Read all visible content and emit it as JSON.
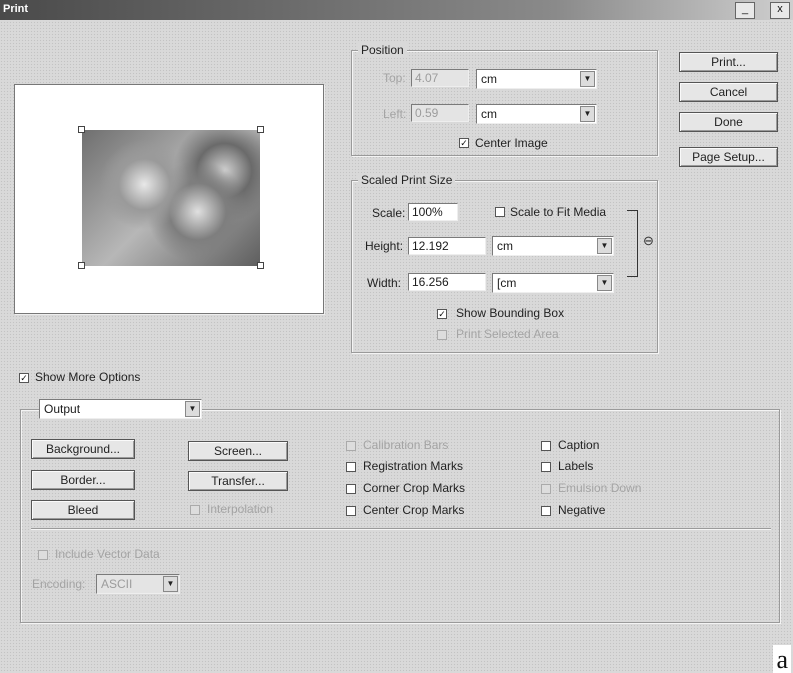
{
  "window": {
    "title": "Print",
    "minimize": "_",
    "close": "x"
  },
  "position": {
    "legend": "Position",
    "top_label": "Top:",
    "top_value": "4.07",
    "top_unit": "cm",
    "left_label": "Left:",
    "left_value": "0.59",
    "left_unit": "cm",
    "center_image_label": "Center Image",
    "center_image_checked": true
  },
  "scaled": {
    "legend": "Scaled Print Size",
    "scale_label": "Scale:",
    "scale_value": "100%",
    "scale_to_fit_label": "Scale to Fit Media",
    "height_label": "Height:",
    "height_value": "12.192",
    "height_unit": "cm",
    "width_label": "Width:",
    "width_value": "16.256",
    "width_unit": "[cm",
    "show_bbox_label": "Show Bounding Box",
    "print_selected_label": "Print Selected Area"
  },
  "buttons": {
    "print": "Print...",
    "cancel": "Cancel",
    "done": "Done",
    "page_setup": "Page Setup..."
  },
  "more_options": {
    "label": "Show More Options",
    "dropdown_value": "Output"
  },
  "output": {
    "background": "Background...",
    "border": "Border...",
    "bleed": "Bleed",
    "screen": "Screen...",
    "transfer": "Transfer...",
    "interpolation": "Interpolation",
    "calibration_bars": "Calibration Bars",
    "registration_marks": "Registration Marks",
    "corner_crop_marks": "Corner Crop Marks",
    "center_crop_marks": "Center Crop Marks",
    "caption": "Caption",
    "labels": "Labels",
    "emulsion_down": "Emulsion Down",
    "negative": "Negative"
  },
  "vector": {
    "include_label": "Include Vector Data",
    "encoding_label": "Encoding:",
    "encoding_value": "ASCII"
  },
  "corner_letter": "a",
  "icons": {
    "dropdown": "chevron-down-icon",
    "check": "checkmark-icon",
    "link": "link-icon"
  }
}
